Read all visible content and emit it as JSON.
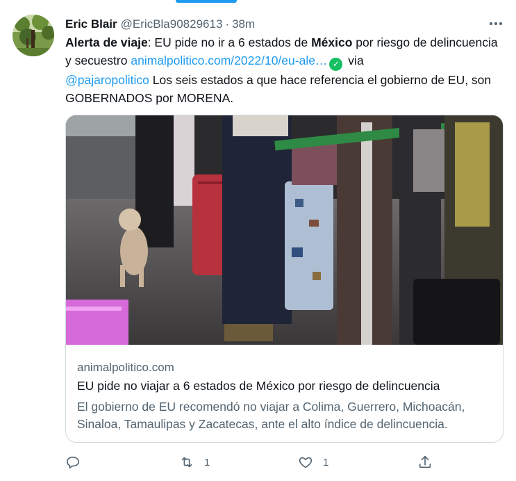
{
  "tweet": {
    "author_name": "Eric Blair",
    "author_handle": "@EricBla90829613",
    "separator": "·",
    "time": "38m",
    "text": {
      "bold_lead": "Alerta de viaje",
      "part1": ": EU pide no ir a 6 estados de ",
      "bold_country": "México",
      "part2": " por riesgo de delincuencia y secuestro ",
      "link": "animalpolitico.com/2022/10/eu-ale…",
      "part3": " via ",
      "mention": "@pajaropolitico",
      "part4": " Los seis estados a que hace referencia el gobierno de EU, son GOBERNADOS por MORENA."
    }
  },
  "card": {
    "domain": "animalpolitico.com",
    "title": "EU pide no viajar a 6 estados de México por riesgo de delincuencia",
    "description": "El gobierno de EU recomendó no viajar a Colima, Guerrero, Michoacán, Sinaloa, Tamaulipas y Zacatecas, ante el alto índice de delincuencia."
  },
  "actions": {
    "reply": {
      "icon": "reply-icon",
      "count": ""
    },
    "retweet": {
      "icon": "retweet-icon",
      "count": "1"
    },
    "like": {
      "icon": "heart-icon",
      "count": "1"
    },
    "share": {
      "icon": "share-icon",
      "count": ""
    }
  },
  "colors": {
    "link": "#1d9bf0",
    "secondary_text": "#536471",
    "border": "#cfd9de",
    "verified": "#17bf63"
  }
}
